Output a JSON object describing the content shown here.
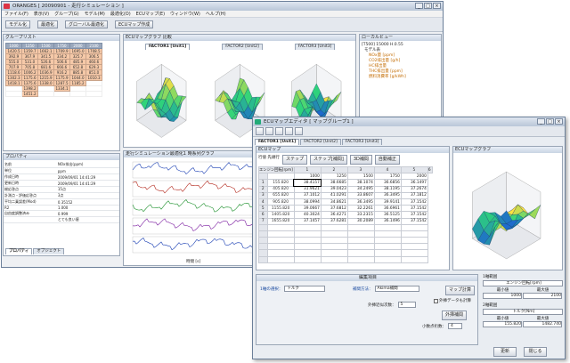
{
  "main_window": {
    "title": "ORANGES [ 20090901 - 走行シミュレーション ]",
    "menu": [
      "ファイル(F)",
      "表示(V)",
      "グループ(G)",
      "モデル(M)",
      "最適化(O)",
      "ECUマップ(E)",
      "ウィンドウ(W)",
      "ヘルプ(H)"
    ],
    "toolbar": [
      "モデル化",
      "最適化",
      "グローバル最適化",
      "ECUマップ作成"
    ]
  },
  "group_list": {
    "title": "グループリスト",
    "rows": [
      [
        "1000",
        "1250",
        "1500",
        "1750",
        "2000",
        "2100"
      ],
      [
        "1420.5",
        "1359.7",
        "1662.1",
        "1709.9",
        "1695.0",
        "1708.5"
      ],
      [
        "392.9",
        "367.9",
        "341.5",
        "334.2",
        "325.7",
        "306.5"
      ],
      [
        "555.0",
        "531.0",
        "526.6",
        "506.6",
        "485.9",
        "460.6"
      ],
      [
        "707.9",
        "705.8",
        "681.6",
        "666.6",
        "652.8",
        "629.3"
      ],
      [
        "1118.6",
        "1006.2",
        "1036.9",
        "916.2",
        "885.8",
        "851.0"
      ],
      [
        "1302.3",
        "1175.6",
        "1215.9",
        "1175.9",
        "1044.0",
        "1010.3"
      ],
      [
        "1418.1",
        "1375.6",
        "1338.0",
        "1287.5",
        "1185.2",
        ""
      ],
      [
        "",
        "1398.2",
        "",
        "1334.1",
        "",
        ""
      ],
      [
        "",
        "1451.2",
        "",
        "",
        "",
        ""
      ]
    ]
  },
  "properties": {
    "title": "プロパティ",
    "rows": [
      [
        "名前",
        "NOx排出(ppm)"
      ],
      [
        "単位",
        "ppm"
      ],
      [
        "作成日時",
        "2009/09/01 14:41:29"
      ],
      [
        "更新日時",
        "2009/09/01 14:41:29"
      ],
      [
        "総応答点",
        "15点"
      ],
      [
        "計測点・評価応答点",
        "3点"
      ],
      [
        "平均二乗誤差(Mod)",
        "0.35152"
      ],
      [
        "R2",
        "1.000"
      ],
      [
        "自由度調整済み",
        "0.999"
      ],
      [
        "",
        "とても良い値"
      ]
    ],
    "tabs": [
      "プロパティ",
      "オブジェクト"
    ]
  },
  "ecu_graph_panel": {
    "title": "ECUマップグラフ 比較",
    "tabs": [
      "FACTOR1 [Unit1]",
      "FACTOR2 [Unit2]",
      "FACTOR3 [Unit3]"
    ]
  },
  "timeseries": {
    "title": "走行シミュレーション最適化1 時系列グラフ",
    "xlabel": "時間 [s]"
  },
  "local_view": {
    "title": "ローカルビュー",
    "items": [
      "[T500] 15000 H.0.55",
      "モデル表",
      "NOx量 [ppm]",
      "CO2排出量 [g/h]",
      "HC排出量",
      "THC排出量 [ppm]",
      "燃料消費率 [g/kWh]"
    ],
    "root": "ローカルビュー"
  },
  "editor": {
    "title": "ECUマップエディタ [ マップグループ1 ]",
    "tabs": [
      "FACTOR1 [Unit1]",
      "FACTOR2 [Unit2]",
      "FACTOR3 [Unit3]"
    ],
    "map_label": "ECUマップ",
    "graph_label": "ECUマップグラフ",
    "toolbar_labels": [
      "ステップ",
      "ステップ[補間]",
      "3D補間",
      "自動補正"
    ],
    "edit_label": "行値 先頭行",
    "col_header": [
      "エンジン回転[rpm]",
      "1",
      "2",
      "3",
      "4",
      "5",
      "6"
    ],
    "col_values": [
      "",
      "1000",
      "1250",
      "1500",
      "1750",
      "2000"
    ],
    "grid": [
      [
        "1",
        "155.820",
        "38.4157",
        "38.6685",
        "38.1074",
        "36.6856",
        "36.1497"
      ],
      [
        "2",
        "405.820",
        "31.9621",
        "39.0423",
        "34.2495",
        "38.1195",
        "37.2674"
      ],
      [
        "3",
        "655.820",
        "37.1012",
        "41.0291",
        "33.8607",
        "36.3495",
        "37.1812"
      ],
      [
        "4",
        "905.820",
        "38.0994",
        "34.8621",
        "36.3495",
        "39.9141",
        "37.1542"
      ],
      [
        "5",
        "1155.820",
        "39.0667",
        "37.6812",
        "32.2261",
        "36.6961",
        "37.1542"
      ],
      [
        "6",
        "1405.820",
        "40.3024",
        "36.4271",
        "33.2315",
        "36.5125",
        "37.1542"
      ],
      [
        "7",
        "1655.820",
        "37.1457",
        "37.6281",
        "30.2089",
        "36.1496",
        "37.1542"
      ]
    ],
    "edit_section": "編集項目",
    "axis_select_label": "1軸の選択：",
    "axis_select_value": "トルク",
    "interp_label": "補間方法：",
    "interp_value": "Akima補間",
    "map_calc_button": "マップ計算",
    "outer_calc_label": "外挿データも計算",
    "outer_count_label": "外挿近似次数：",
    "outer_count_value": "5",
    "outer_interp_button": "外挿補間",
    "decimal_label": "小数点桁数：",
    "decimal_value": "4",
    "right_axis1_title": "1軸範囲",
    "right_axis1_name": "エンジン回転[rpm]",
    "right_axis1_min_label": "最小値",
    "right_axis1_max_label": "最大値",
    "right_axis1_min": "1000",
    "right_axis1_max": "2100",
    "right_axis2_title": "2軸範囲",
    "right_axis2_name": "トルク[Nm]",
    "right_axis2_min_label": "最小値",
    "right_axis2_max_label": "最大値",
    "right_axis2_min": "155.820",
    "right_axis2_max": "1482.740",
    "update_button": "更新",
    "close_button": "閉じる"
  },
  "colors": {
    "surface_low": "#1b5bd8",
    "surface_mid": "#2ed47a",
    "surface_high": "#ffe040",
    "grid_orange": "#f6c9a8"
  }
}
